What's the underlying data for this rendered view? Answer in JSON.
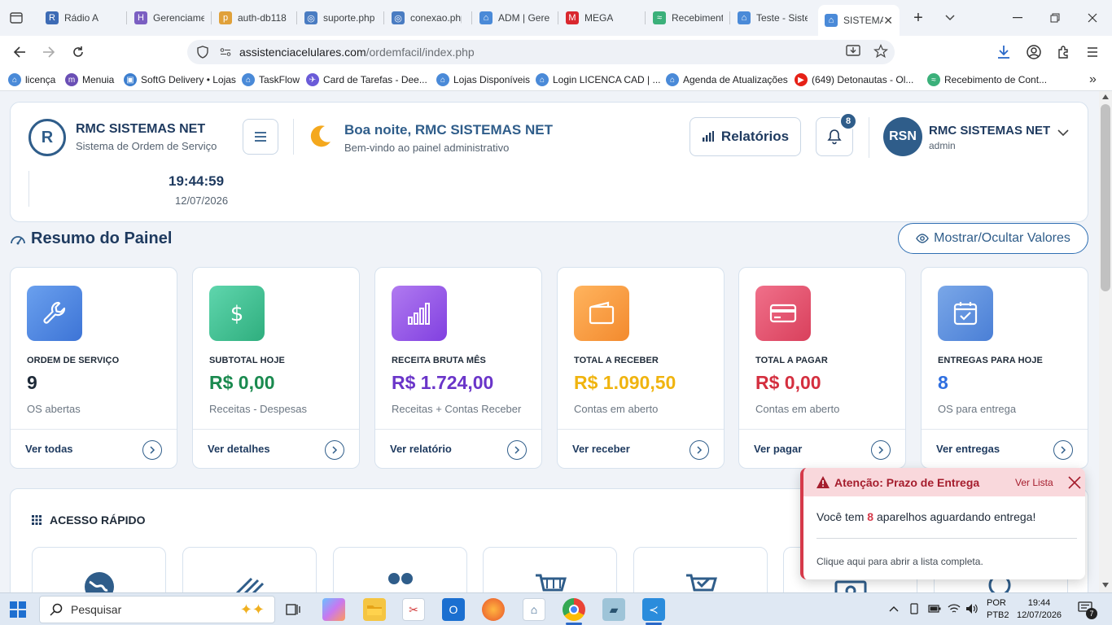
{
  "browser": {
    "tabs": [
      {
        "title": "Rádio A",
        "fav": "R",
        "color": "#3d6bb5"
      },
      {
        "title": "Gerenciame",
        "fav": "H",
        "color": "#7b5fc2"
      },
      {
        "title": "auth-db118",
        "fav": "p",
        "color": "#e0a13a"
      },
      {
        "title": "suporte.php",
        "fav": "◎",
        "color": "#4a7cc2"
      },
      {
        "title": "conexao.php",
        "fav": "◎",
        "color": "#4a7cc2"
      },
      {
        "title": "ADM | Gere",
        "fav": "⌂",
        "color": "#4a8ad8"
      },
      {
        "title": "MEGA",
        "fav": "M",
        "color": "#d9272e"
      },
      {
        "title": "Recebiment",
        "fav": "≈",
        "color": "#3bb07a"
      },
      {
        "title": "Teste - Siste",
        "fav": "⌂",
        "color": "#4a8ad8"
      }
    ],
    "active_tab": "SISTEMA",
    "url_host": "assistenciacelulares.com",
    "url_path": "/ordemfacil/index.php",
    "bookmarks": [
      {
        "label": "licença",
        "fav": "⌂",
        "color": "#4a8ad8"
      },
      {
        "label": "Menuia",
        "fav": "m",
        "color": "#6a4fb5"
      },
      {
        "label": "SoftG Delivery • Lojas",
        "fav": "▣",
        "color": "#3d7fcf"
      },
      {
        "label": "TaskFlow",
        "fav": "⌂",
        "color": "#4a8ad8"
      },
      {
        "label": "Card de Tarefas - Dee...",
        "fav": "✈",
        "color": "#6a5bd8"
      },
      {
        "label": "Lojas Disponíveis",
        "fav": "⌂",
        "color": "#4a8ad8"
      },
      {
        "label": "Login LICENCA CAD  | ...",
        "fav": "⌂",
        "color": "#4a8ad8"
      },
      {
        "label": "Agenda de Atualizações",
        "fav": "⌂",
        "color": "#4a8ad8"
      },
      {
        "label": "(649) Detonautas - Ol...",
        "fav": "▶",
        "color": "#e62117"
      },
      {
        "label": "Recebimento de Cont...",
        "fav": "≈",
        "color": "#3bb07a"
      }
    ]
  },
  "header": {
    "logo_letter": "R",
    "brand_name": "RMC SISTEMAS NET",
    "brand_sub": "Sistema de Ordem de Serviço",
    "greeting": "Boa noite, RMC SISTEMAS NET",
    "greeting_sub": "Bem-vindo ao painel administrativo",
    "reports_label": "Relatórios",
    "notification_count": "8",
    "avatar_initials": "RSN",
    "user_name": "RMC SISTEMAS NET",
    "user_role": "admin",
    "clock_time": "19:44:59",
    "clock_date": "12/07/2026"
  },
  "dashboard": {
    "title": "Resumo do Painel",
    "toggle_label": "Mostrar/Ocultar Valores",
    "cards": [
      {
        "label": "ORDEM DE SERVIÇO",
        "value": "9",
        "sub": "OS abertas",
        "link": "Ver todas",
        "icon": "wrench-icon",
        "value_color": "#1e2a38",
        "grad": [
          "#6aa0ee",
          "#3d74d6"
        ]
      },
      {
        "label": "SUBTOTAL HOJE",
        "value": "R$ 0,00",
        "sub": "Receitas - Despesas",
        "link": "Ver detalhes",
        "icon": "dollar-icon",
        "value_color": "#1a8a4f",
        "grad": [
          "#5fd6ad",
          "#2fae7e"
        ]
      },
      {
        "label": "RECEITA BRUTA MÊS",
        "value": "R$ 1.724,00",
        "sub": "Receitas + Contas Receber",
        "link": "Ver relatório",
        "icon": "bar-chart-icon",
        "value_color": "#6a35c9",
        "grad": [
          "#b07af0",
          "#8140e0"
        ]
      },
      {
        "label": "TOTAL A RECEBER",
        "value": "R$ 1.090,50",
        "sub": "Contas em aberto",
        "link": "Ver receber",
        "icon": "wallet-icon",
        "value_color": "#f0b40f",
        "grad": [
          "#ffb45e",
          "#f38a2e"
        ]
      },
      {
        "label": "TOTAL A PAGAR",
        "value": "R$ 0,00",
        "sub": "Contas em aberto",
        "link": "Ver pagar",
        "icon": "credit-card-icon",
        "value_color": "#d42f3f",
        "grad": [
          "#f0708a",
          "#d9405c"
        ]
      },
      {
        "label": "ENTREGAS PARA HOJE",
        "value": "8",
        "sub": "OS para entrega",
        "link": "Ver entregas",
        "icon": "calendar-check-icon",
        "value_color": "#2f6fe0",
        "grad": [
          "#7aa7e8",
          "#4a7fd6"
        ]
      }
    ]
  },
  "quick_access": {
    "title": "ACESSO RÁPIDO"
  },
  "toast": {
    "title": "Atenção: Prazo de Entrega",
    "link": "Ver Lista",
    "msg_before": "Você tem",
    "count": "8",
    "msg_after": "aparelhos aguardando entrega!",
    "footer": "Clique aqui para abrir a lista completa."
  },
  "taskbar": {
    "search_placeholder": "Pesquisar",
    "lang_top": "POR",
    "lang_bottom": "PTB2",
    "time": "19:44",
    "date": "12/07/2026",
    "notif_count": "7"
  }
}
